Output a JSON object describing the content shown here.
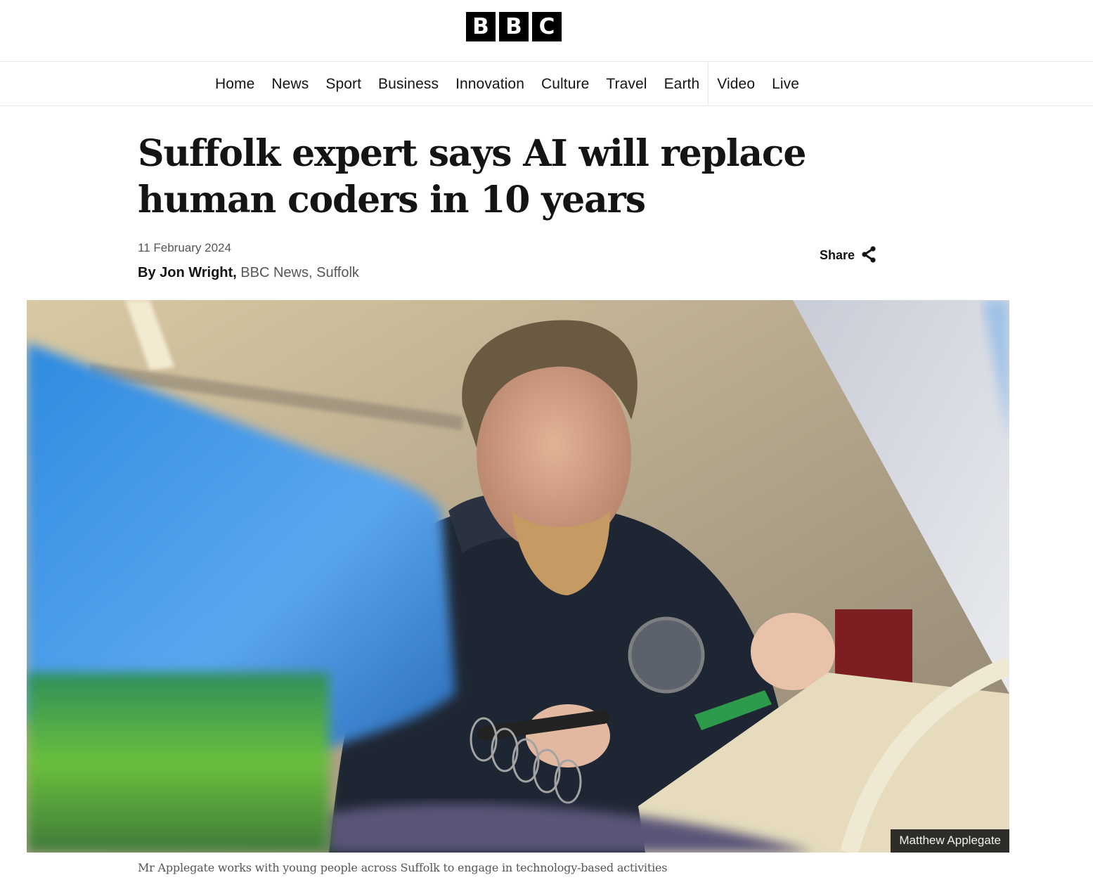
{
  "brand": {
    "logo_letters": [
      "B",
      "B",
      "C"
    ],
    "logo_label": "BBC"
  },
  "nav": {
    "items": [
      {
        "label": "Home"
      },
      {
        "label": "News"
      },
      {
        "label": "Sport"
      },
      {
        "label": "Business"
      },
      {
        "label": "Innovation"
      },
      {
        "label": "Culture"
      },
      {
        "label": "Travel"
      },
      {
        "label": "Earth"
      },
      {
        "label": "Video"
      },
      {
        "label": "Live"
      }
    ]
  },
  "article": {
    "headline": "Suffolk expert says AI will replace human coders in 10 years",
    "date": "11 February 2024",
    "byline": {
      "author": "By Jon Wright,",
      "organisation": " BBC News, Suffolk"
    },
    "share": {
      "label": "Share",
      "icon": "share-icon"
    },
    "image": {
      "alt": "Man with beard soldering a circuit board using a magnifying glass",
      "credit": "Matthew Applegate",
      "caption": "Mr Applegate works with young people across Suffolk to engage in technology-based activities"
    }
  }
}
